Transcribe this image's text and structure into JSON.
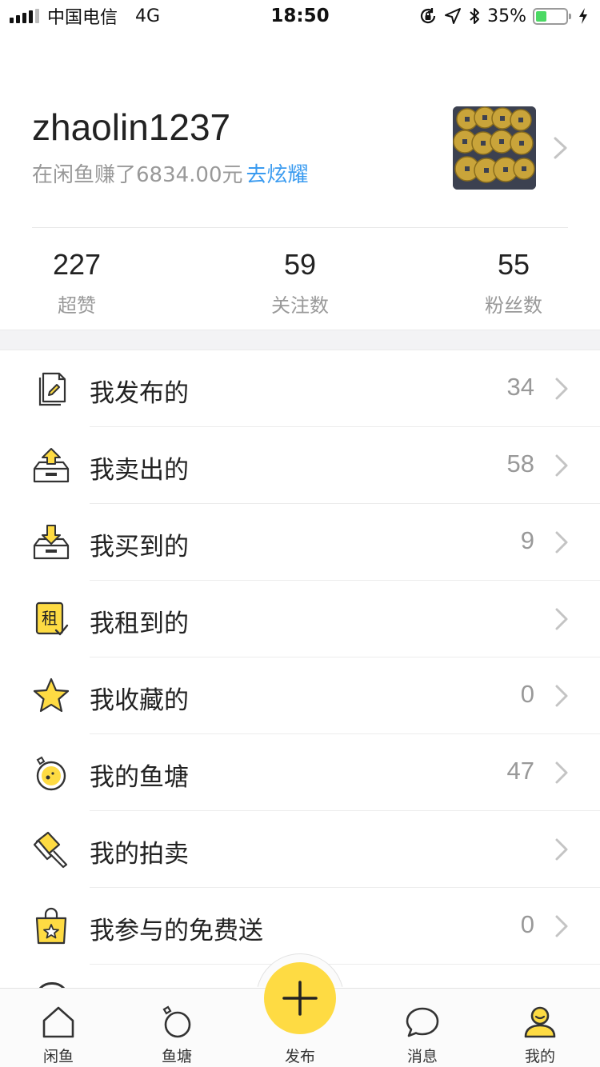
{
  "status_bar": {
    "carrier": "中国电信",
    "network": "4G",
    "time": "18:50",
    "battery_percent": "35%",
    "battery_level": 0.35,
    "icons": [
      "orientation-lock-icon",
      "location-icon",
      "bluetooth-icon",
      "charging-icon"
    ]
  },
  "profile": {
    "username": "zhaolin1237",
    "earned_text": "在闲鱼赚了6834.00元",
    "brag_link": "去炫耀"
  },
  "stats": [
    {
      "value": "227",
      "label": "超赞"
    },
    {
      "value": "59",
      "label": "关注数"
    },
    {
      "value": "55",
      "label": "粉丝数"
    }
  ],
  "menu": [
    {
      "label": "我发布的",
      "count": "34",
      "icon": "published-doc-icon"
    },
    {
      "label": "我卖出的",
      "count": "58",
      "icon": "sold-box-icon"
    },
    {
      "label": "我买到的",
      "count": "9",
      "icon": "bought-box-icon"
    },
    {
      "label": "我租到的",
      "count": "",
      "icon": "rent-icon",
      "icon_text": "租"
    },
    {
      "label": "我收藏的",
      "count": "0",
      "icon": "star-icon"
    },
    {
      "label": "我的鱼塘",
      "count": "47",
      "icon": "fishpond-icon"
    },
    {
      "label": "我的拍卖",
      "count": "",
      "icon": "auction-hammer-icon"
    },
    {
      "label": "我参与的免费送",
      "count": "0",
      "icon": "free-gift-bag-icon"
    }
  ],
  "tab_bar": {
    "tabs": [
      {
        "label": "闲鱼",
        "icon": "home-icon"
      },
      {
        "label": "鱼塘",
        "icon": "pond-icon"
      },
      {
        "label": "发布",
        "icon": "plus-icon"
      },
      {
        "label": "消息",
        "icon": "message-icon"
      },
      {
        "label": "我的",
        "icon": "profile-icon"
      }
    ]
  },
  "colors": {
    "accent_yellow": "#fedb43",
    "link_blue": "#3a9bf0",
    "muted_text": "#999999"
  }
}
